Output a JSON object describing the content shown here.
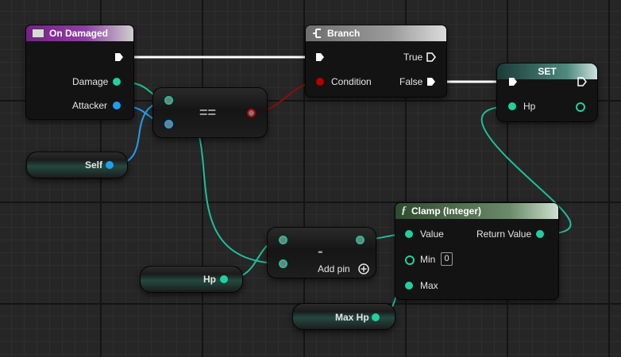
{
  "nodes": {
    "on_damaged": {
      "title": "On Damaged",
      "pins": {
        "damage": "Damage",
        "attacker": "Attacker"
      }
    },
    "branch": {
      "title": "Branch",
      "pins": {
        "condition": "Condition",
        "true": "True",
        "false": "False"
      }
    },
    "set": {
      "title": "SET",
      "pins": {
        "hp": "Hp"
      }
    },
    "equal": {
      "symbol": "=="
    },
    "subtract": {
      "symbol": "-",
      "add_pin": "Add pin"
    },
    "clamp": {
      "title": "Clamp (Integer)",
      "pins": {
        "value": "Value",
        "min": "Min",
        "min_default": "0",
        "max": "Max",
        "return": "Return Value"
      }
    },
    "self": {
      "label": "Self"
    },
    "hp_var": {
      "label": "Hp"
    },
    "max_hp_var": {
      "label": "Max Hp"
    }
  },
  "colors": {
    "exec": "#ffffff",
    "integer": "#20d0a0",
    "object": "#1f9ff0",
    "boolean": "#b30000",
    "event_header": "#7a1d8a",
    "branch_header": "#8a8a8a",
    "set_header": "#4e8a80",
    "function_header": "#6a8a6a"
  },
  "icons": {
    "event": "event-icon",
    "branch": "branch-icon",
    "function": "function-icon",
    "add": "add-pin-icon"
  }
}
